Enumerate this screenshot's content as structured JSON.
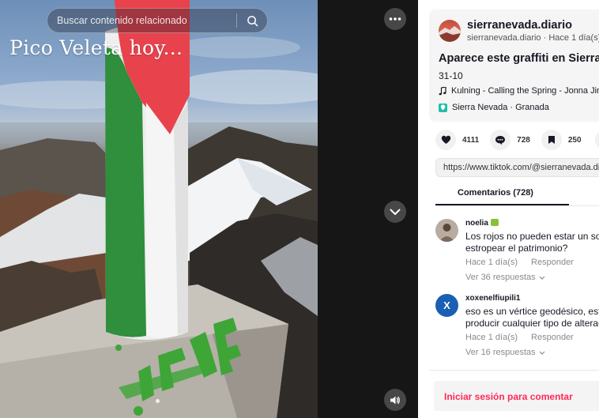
{
  "video": {
    "search_placeholder": "Buscar contenido relacionado",
    "overlay_title": "Pico Veleta hoy..."
  },
  "post": {
    "username": "sierranevada.diario",
    "handle": "sierranevada.diario",
    "time_ago": "Hace 1 día(s)",
    "handle_time": "sierranevada.diario · Hace 1 día(s)",
    "caption": "Aparece este graffiti en Sierra",
    "date": "31-10",
    "music": "Kulning - Calling the Spring - Jonna Jinton",
    "location": "Sierra Nevada · Granada"
  },
  "actions": {
    "likes": "4111",
    "comments": "728",
    "saves": "250"
  },
  "share_link": "https://www.tiktok.com/@sierranevada.diario",
  "tabs": {
    "comments_label": "Comentarios (728)"
  },
  "comments": [
    {
      "author": "noelia",
      "text_line1": "Los rojos no pueden estar un solo",
      "text_line2": "estropear el patrimonio?",
      "time": "Hace 1 día(s)",
      "reply_label": "Responder",
      "more_replies": "Ver 36 respuestas"
    },
    {
      "author": "xoxenelfiupili1",
      "avatar_letter": "X",
      "text_line1": "eso es un vértice geodésico, esta",
      "text_line2": "producir cualquier tipo de alteración",
      "time": "Hace 1 día(s)",
      "reply_label": "Responder",
      "more_replies": "Ver 16 respuestas"
    }
  ],
  "login_prompt": "Iniciar sesión para comentar",
  "icons": {
    "search": "search-icon",
    "more": "more-horizontal-icon",
    "next_video": "chevron-down-icon",
    "volume": "volume-icon",
    "music": "music-note-icon",
    "location": "location-pin-icon",
    "heart": "heart-icon",
    "comment": "comment-icon",
    "bookmark": "bookmark-icon"
  },
  "colors": {
    "accent_red": "#fe2c55",
    "text_primary": "#161823",
    "text_secondary": "#8a8b91",
    "strip_bg": "#161616",
    "comment_avatar_x": "#1a5fb4"
  }
}
